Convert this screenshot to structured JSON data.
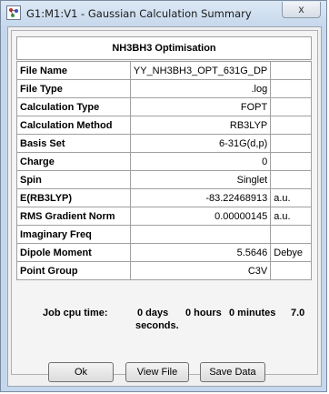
{
  "window": {
    "title": "G1:M1:V1 - Gaussian Calculation Summary",
    "close_glyph": "x"
  },
  "summary": {
    "heading": "NH3BH3 Optimisation",
    "rows": [
      {
        "label": "File Name",
        "value": "YY_NH3BH3_OPT_631G_DP",
        "unit": ""
      },
      {
        "label": "File Type",
        "value": ".log",
        "unit": ""
      },
      {
        "label": "Calculation Type",
        "value": "FOPT",
        "unit": ""
      },
      {
        "label": "Calculation Method",
        "value": "RB3LYP",
        "unit": ""
      },
      {
        "label": "Basis Set",
        "value": "6-31G(d,p)",
        "unit": ""
      },
      {
        "label": "Charge",
        "value": "0",
        "unit": ""
      },
      {
        "label": "Spin",
        "value": "Singlet",
        "unit": ""
      },
      {
        "label": "E(RB3LYP)",
        "value": "-83.22468913",
        "unit": "a.u."
      },
      {
        "label": "RMS Gradient Norm",
        "value": "0.00000145",
        "unit": "a.u."
      },
      {
        "label": "Imaginary Freq",
        "value": "",
        "unit": ""
      },
      {
        "label": "Dipole Moment",
        "value": "5.5646",
        "unit": "Debye"
      },
      {
        "label": "Point Group",
        "value": "C3V",
        "unit": ""
      }
    ]
  },
  "cpu": {
    "label": "Job cpu time:",
    "days": "0 days",
    "hours": "0 hours",
    "minutes": "0 minutes",
    "seconds_value": "7.0",
    "seconds_label": "seconds."
  },
  "buttons": {
    "ok": "Ok",
    "view_file": "View File",
    "save_data": "Save Data"
  }
}
